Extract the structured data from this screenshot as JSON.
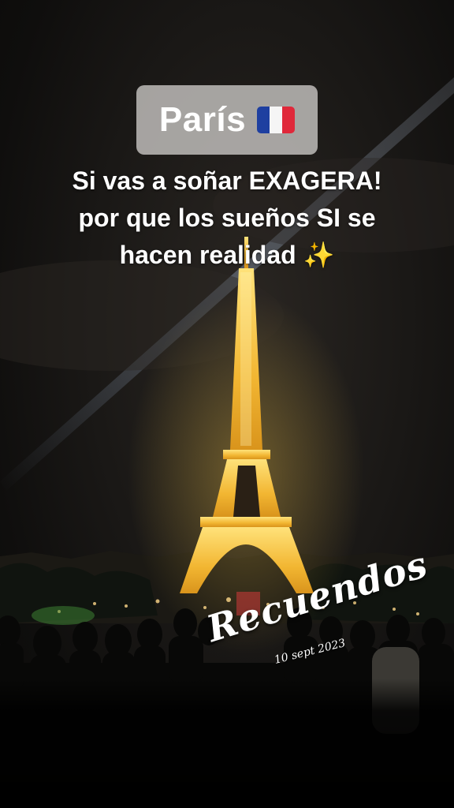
{
  "overlay": {
    "title": "París",
    "flag_icon": "france-flag-icon",
    "flag_colors": [
      "#1e3fa0",
      "#f5f5f5",
      "#e0283a"
    ],
    "caption_lines": [
      "Si vas a soñar EXAGERA!",
      "por que los sueños SI se",
      "hacen realidad"
    ],
    "caption_emoji": "✨",
    "sticker_text": "Recuendos",
    "date_text": "10 sept 2023"
  },
  "colors": {
    "tower_light": "#f2b632",
    "text": "#ffffff",
    "title_box": "#cdcbc8"
  }
}
